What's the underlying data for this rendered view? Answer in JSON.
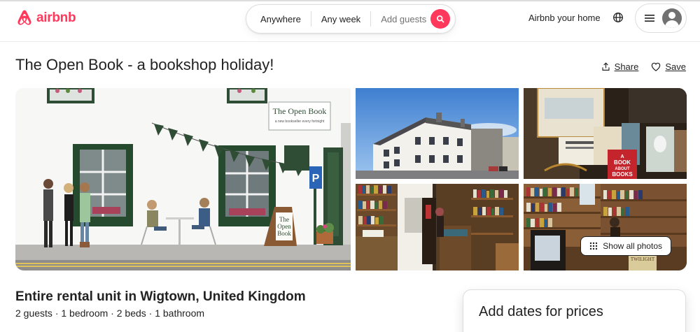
{
  "brand": {
    "name": "airbnb",
    "color": "#FF385C"
  },
  "search": {
    "location": "Anywhere",
    "week": "Any week",
    "guests_placeholder": "Add guests",
    "icon": "search-icon"
  },
  "nav": {
    "host_link": "Airbnb your home",
    "globe_icon": "globe-icon",
    "menu_icon": "hamburger-icon",
    "avatar_icon": "user-avatar-icon"
  },
  "listing": {
    "title": "The Open Book - a bookshop holiday!",
    "share_label": "Share",
    "save_label": "Save",
    "show_all_photos": "Show all photos",
    "type_location": "Entire rental unit in Wigtown, United Kingdom",
    "details": "2 guests · 1 bedroom · 2 beds · 1 bathroom"
  },
  "photos": {
    "main_sign": "The Open Book",
    "main_sign_sub": "a new bookseller every fortnight",
    "door_sign_line1": "The",
    "door_sign_line2": "Open",
    "door_sign_line3": "Book",
    "book_display_line1": "A",
    "book_display_line2": "BOOK",
    "book_display_line3": "ABOUT",
    "book_display_line4": "BOOKS",
    "shelf_book_label": "TWILIGHT"
  },
  "booking": {
    "heading": "Add dates for prices"
  }
}
